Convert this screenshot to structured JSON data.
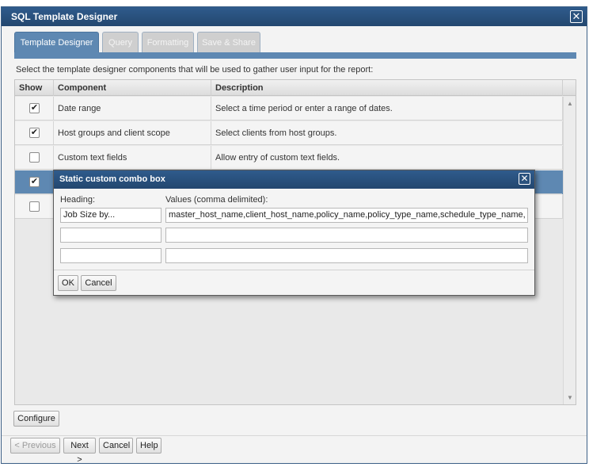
{
  "window": {
    "title": "SQL Template Designer",
    "close_symbol": "✕"
  },
  "tabs": [
    {
      "label": "Template Designer",
      "active": true
    },
    {
      "label": "Query",
      "active": false
    },
    {
      "label": "Formatting",
      "active": false
    },
    {
      "label": "Save & Share",
      "active": false
    }
  ],
  "intro_text": "Select the template designer components that will be used to gather user input for the report:",
  "grid": {
    "headers": {
      "show": "Show",
      "component": "Component",
      "description": "Description"
    },
    "rows": [
      {
        "checked": true,
        "check_symbol": "✔",
        "component": "Date range",
        "description": "Select a time period or enter a range of dates."
      },
      {
        "checked": true,
        "check_symbol": "✔",
        "component": "Host groups and client scope",
        "description": "Select clients from host groups."
      },
      {
        "checked": false,
        "check_symbol": "",
        "component": "Custom text fields",
        "description": "Allow entry of custom text fields."
      },
      {
        "checked": true,
        "check_symbol": "✔",
        "component": "",
        "description": ""
      },
      {
        "checked": false,
        "check_symbol": "",
        "component": "",
        "description": ""
      }
    ],
    "scroll_up": "▲",
    "scroll_down": "▼"
  },
  "configure_label": "Configure",
  "footer": {
    "previous_label": "< Previous",
    "next_label": "Next >",
    "cancel_label": "Cancel",
    "help_label": "Help"
  },
  "modal": {
    "title": "Static custom combo box",
    "close_symbol": "✕",
    "heading_label": "Heading:",
    "values_label": "Values (comma delimited):",
    "rows": [
      {
        "heading": "Job Size by...",
        "values": "master_host_name,client_host_name,policy_name,policy_type_name,schedule_type_name,"
      },
      {
        "heading": "",
        "values": ""
      },
      {
        "heading": "",
        "values": ""
      }
    ],
    "ok_label": "OK",
    "cancel_label": "Cancel"
  },
  "colors": {
    "titlebar": "#2f5b8c",
    "tab_active": "#5e88b2",
    "row_selected": "#5e88b2"
  }
}
